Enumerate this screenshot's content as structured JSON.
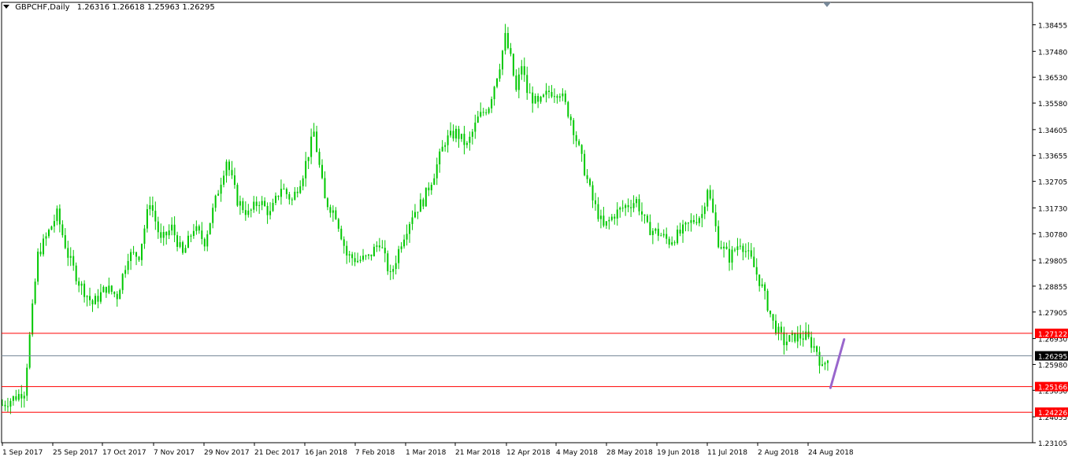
{
  "header": {
    "symbol": "GBPCHF,Daily",
    "ohlc": "1.26316 1.26618 1.25963 1.26295"
  },
  "chart_data": {
    "type": "candlestick",
    "symbol": "GBPCHF",
    "timeframe": "Daily",
    "ylim": [
      1.23105,
      1.38875
    ],
    "y_ticks": [
      "1.38455",
      "1.37480",
      "1.36530",
      "1.35580",
      "1.34605",
      "1.33655",
      "1.32705",
      "1.31730",
      "1.30780",
      "1.29805",
      "1.28855",
      "1.27905",
      "1.26930",
      "1.25980",
      "1.25030",
      "1.24055",
      "1.23105"
    ],
    "x_ticks": [
      "1 Sep 2017",
      "25 Sep 2017",
      "17 Oct 2017",
      "7 Nov 2017",
      "29 Nov 2017",
      "21 Dec 2017",
      "16 Jan 2018",
      "7 Feb 2018",
      "1 Mar 2018",
      "21 Mar 2018",
      "12 Apr 2018",
      "4 May 2018",
      "28 May 2018",
      "19 Jun 2018",
      "11 Jul 2018",
      "2 Aug 2018",
      "24 Aug 2018"
    ],
    "anchors": [
      [
        0,
        1.245
      ],
      [
        5,
        1.248
      ],
      [
        8,
        1.25
      ],
      [
        10,
        1.27
      ],
      [
        13,
        1.3
      ],
      [
        20,
        1.315
      ],
      [
        24,
        1.3
      ],
      [
        28,
        1.29
      ],
      [
        33,
        1.282
      ],
      [
        38,
        1.288
      ],
      [
        42,
        1.285
      ],
      [
        46,
        1.3
      ],
      [
        50,
        1.3
      ],
      [
        54,
        1.32
      ],
      [
        58,
        1.305
      ],
      [
        62,
        1.31
      ],
      [
        66,
        1.3
      ],
      [
        70,
        1.31
      ],
      [
        74,
        1.305
      ],
      [
        78,
        1.32
      ],
      [
        82,
        1.335
      ],
      [
        86,
        1.32
      ],
      [
        90,
        1.315
      ],
      [
        94,
        1.32
      ],
      [
        98,
        1.315
      ],
      [
        102,
        1.325
      ],
      [
        106,
        1.32
      ],
      [
        110,
        1.33
      ],
      [
        114,
        1.345
      ],
      [
        118,
        1.32
      ],
      [
        122,
        1.315
      ],
      [
        126,
        1.3
      ],
      [
        130,
        1.298
      ],
      [
        134,
        1.299
      ],
      [
        138,
        1.305
      ],
      [
        142,
        1.292
      ],
      [
        146,
        1.305
      ],
      [
        150,
        1.315
      ],
      [
        154,
        1.32
      ],
      [
        158,
        1.33
      ],
      [
        162,
        1.342
      ],
      [
        166,
        1.345
      ],
      [
        170,
        1.34
      ],
      [
        174,
        1.35
      ],
      [
        178,
        1.355
      ],
      [
        182,
        1.37
      ],
      [
        184,
        1.38
      ],
      [
        186,
        1.372
      ],
      [
        188,
        1.36
      ],
      [
        190,
        1.37
      ],
      [
        192,
        1.36
      ],
      [
        196,
        1.355
      ],
      [
        200,
        1.36
      ],
      [
        204,
        1.36
      ],
      [
        208,
        1.35
      ],
      [
        212,
        1.335
      ],
      [
        216,
        1.32
      ],
      [
        220,
        1.31
      ],
      [
        224,
        1.315
      ],
      [
        228,
        1.318
      ],
      [
        232,
        1.32
      ],
      [
        236,
        1.31
      ],
      [
        240,
        1.308
      ],
      [
        244,
        1.305
      ],
      [
        248,
        1.308
      ],
      [
        252,
        1.312
      ],
      [
        256,
        1.315
      ],
      [
        258,
        1.325
      ],
      [
        262,
        1.305
      ],
      [
        266,
        1.299
      ],
      [
        270,
        1.305
      ],
      [
        274,
        1.298
      ],
      [
        278,
        1.288
      ],
      [
        282,
        1.275
      ],
      [
        286,
        1.268
      ],
      [
        290,
        1.27
      ],
      [
        294,
        1.27
      ],
      [
        298,
        1.265
      ],
      [
        300,
        1.258
      ],
      [
        302,
        1.263
      ]
    ],
    "levels": [
      {
        "label": "1.27122",
        "value": 1.27122,
        "color": "#ff0000"
      },
      {
        "label": "1.25166",
        "value": 1.25166,
        "color": "#ff0000"
      },
      {
        "label": "1.24226",
        "value": 1.24226,
        "color": "#ff0000"
      }
    ],
    "current_price": {
      "label": "1.26295",
      "value": 1.26295,
      "color": "#778899"
    },
    "trendline": {
      "color": "#9966cc",
      "from": [
        303,
        1.2512
      ],
      "to": [
        308,
        1.269
      ]
    },
    "candle_color": "#00c800",
    "grid": false
  }
}
